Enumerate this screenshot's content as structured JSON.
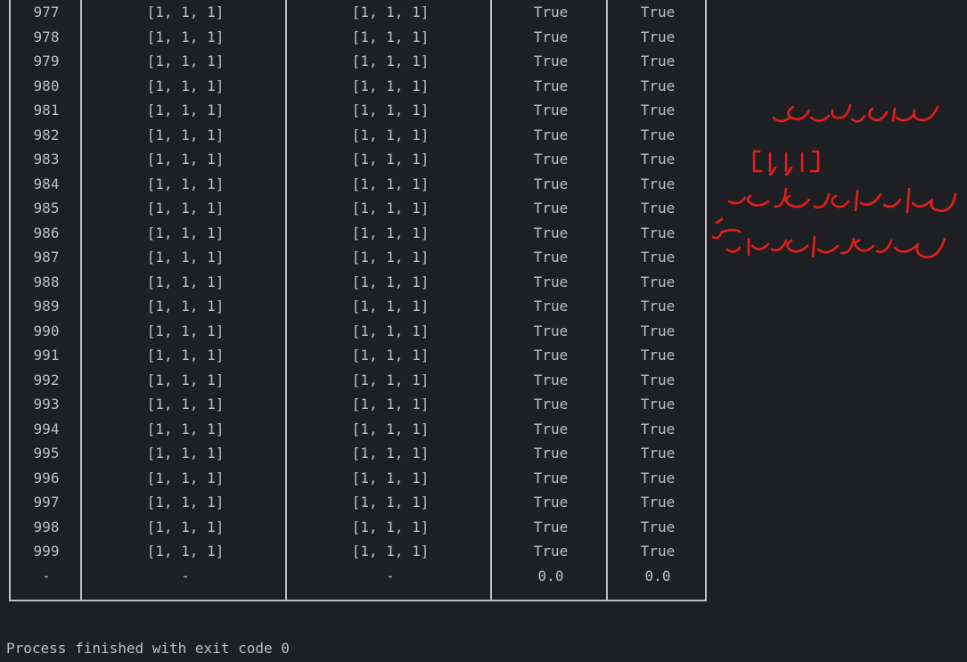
{
  "rows": [
    [
      "977",
      "[1, 1, 1]",
      "[1, 1, 1]",
      "True",
      "True"
    ],
    [
      "978",
      "[1, 1, 1]",
      "[1, 1, 1]",
      "True",
      "True"
    ],
    [
      "979",
      "[1, 1, 1]",
      "[1, 1, 1]",
      "True",
      "True"
    ],
    [
      "980",
      "[1, 1, 1]",
      "[1, 1, 1]",
      "True",
      "True"
    ],
    [
      "981",
      "[1, 1, 1]",
      "[1, 1, 1]",
      "True",
      "True"
    ],
    [
      "982",
      "[1, 1, 1]",
      "[1, 1, 1]",
      "True",
      "True"
    ],
    [
      "983",
      "[1, 1, 1]",
      "[1, 1, 1]",
      "True",
      "True"
    ],
    [
      "984",
      "[1, 1, 1]",
      "[1, 1, 1]",
      "True",
      "True"
    ],
    [
      "985",
      "[1, 1, 1]",
      "[1, 1, 1]",
      "True",
      "True"
    ],
    [
      "986",
      "[1, 1, 1]",
      "[1, 1, 1]",
      "True",
      "True"
    ],
    [
      "987",
      "[1, 1, 1]",
      "[1, 1, 1]",
      "True",
      "True"
    ],
    [
      "988",
      "[1, 1, 1]",
      "[1, 1, 1]",
      "True",
      "True"
    ],
    [
      "989",
      "[1, 1, 1]",
      "[1, 1, 1]",
      "True",
      "True"
    ],
    [
      "990",
      "[1, 1, 1]",
      "[1, 1, 1]",
      "True",
      "True"
    ],
    [
      "991",
      "[1, 1, 1]",
      "[1, 1, 1]",
      "True",
      "True"
    ],
    [
      "992",
      "[1, 1, 1]",
      "[1, 1, 1]",
      "True",
      "True"
    ],
    [
      "993",
      "[1, 1, 1]",
      "[1, 1, 1]",
      "True",
      "True"
    ],
    [
      "994",
      "[1, 1, 1]",
      "[1, 1, 1]",
      "True",
      "True"
    ],
    [
      "995",
      "[1, 1, 1]",
      "[1, 1, 1]",
      "True",
      "True"
    ],
    [
      "996",
      "[1, 1, 1]",
      "[1, 1, 1]",
      "True",
      "True"
    ],
    [
      "997",
      "[1, 1, 1]",
      "[1, 1, 1]",
      "True",
      "True"
    ],
    [
      "998",
      "[1, 1, 1]",
      "[1, 1, 1]",
      "True",
      "True"
    ],
    [
      "999",
      "[1, 1, 1]",
      "[1, 1, 1]",
      "True",
      "True"
    ],
    [
      "-",
      "-",
      "-",
      "0.0",
      "0.0"
    ]
  ],
  "footer": "Process finished with exit code 0",
  "colors": {
    "background": "#1e1f22",
    "text": "#bcbec4",
    "annotation": "#e0201a"
  },
  "annotation_lines": [
    "سناریو ورودی",
    "[1,1,1]",
    "که در آن نرخ خطای",
    "شبکه صفر شده است."
  ]
}
